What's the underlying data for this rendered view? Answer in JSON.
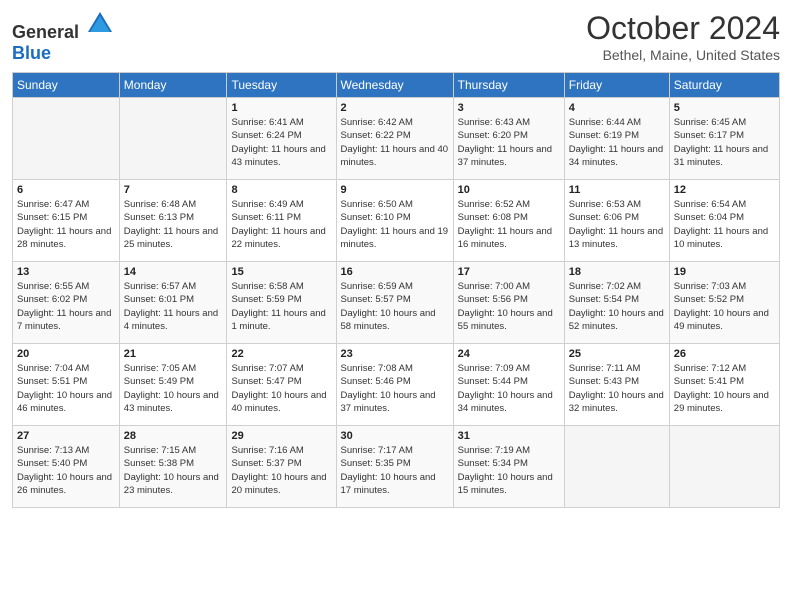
{
  "header": {
    "logo_general": "General",
    "logo_blue": "Blue",
    "title": "October 2024",
    "location": "Bethel, Maine, United States"
  },
  "weekdays": [
    "Sunday",
    "Monday",
    "Tuesday",
    "Wednesday",
    "Thursday",
    "Friday",
    "Saturday"
  ],
  "weeks": [
    [
      {
        "day": "",
        "sunrise": "",
        "sunset": "",
        "daylight": ""
      },
      {
        "day": "",
        "sunrise": "",
        "sunset": "",
        "daylight": ""
      },
      {
        "day": "1",
        "sunrise": "Sunrise: 6:41 AM",
        "sunset": "Sunset: 6:24 PM",
        "daylight": "Daylight: 11 hours and 43 minutes."
      },
      {
        "day": "2",
        "sunrise": "Sunrise: 6:42 AM",
        "sunset": "Sunset: 6:22 PM",
        "daylight": "Daylight: 11 hours and 40 minutes."
      },
      {
        "day": "3",
        "sunrise": "Sunrise: 6:43 AM",
        "sunset": "Sunset: 6:20 PM",
        "daylight": "Daylight: 11 hours and 37 minutes."
      },
      {
        "day": "4",
        "sunrise": "Sunrise: 6:44 AM",
        "sunset": "Sunset: 6:19 PM",
        "daylight": "Daylight: 11 hours and 34 minutes."
      },
      {
        "day": "5",
        "sunrise": "Sunrise: 6:45 AM",
        "sunset": "Sunset: 6:17 PM",
        "daylight": "Daylight: 11 hours and 31 minutes."
      }
    ],
    [
      {
        "day": "6",
        "sunrise": "Sunrise: 6:47 AM",
        "sunset": "Sunset: 6:15 PM",
        "daylight": "Daylight: 11 hours and 28 minutes."
      },
      {
        "day": "7",
        "sunrise": "Sunrise: 6:48 AM",
        "sunset": "Sunset: 6:13 PM",
        "daylight": "Daylight: 11 hours and 25 minutes."
      },
      {
        "day": "8",
        "sunrise": "Sunrise: 6:49 AM",
        "sunset": "Sunset: 6:11 PM",
        "daylight": "Daylight: 11 hours and 22 minutes."
      },
      {
        "day": "9",
        "sunrise": "Sunrise: 6:50 AM",
        "sunset": "Sunset: 6:10 PM",
        "daylight": "Daylight: 11 hours and 19 minutes."
      },
      {
        "day": "10",
        "sunrise": "Sunrise: 6:52 AM",
        "sunset": "Sunset: 6:08 PM",
        "daylight": "Daylight: 11 hours and 16 minutes."
      },
      {
        "day": "11",
        "sunrise": "Sunrise: 6:53 AM",
        "sunset": "Sunset: 6:06 PM",
        "daylight": "Daylight: 11 hours and 13 minutes."
      },
      {
        "day": "12",
        "sunrise": "Sunrise: 6:54 AM",
        "sunset": "Sunset: 6:04 PM",
        "daylight": "Daylight: 11 hours and 10 minutes."
      }
    ],
    [
      {
        "day": "13",
        "sunrise": "Sunrise: 6:55 AM",
        "sunset": "Sunset: 6:02 PM",
        "daylight": "Daylight: 11 hours and 7 minutes."
      },
      {
        "day": "14",
        "sunrise": "Sunrise: 6:57 AM",
        "sunset": "Sunset: 6:01 PM",
        "daylight": "Daylight: 11 hours and 4 minutes."
      },
      {
        "day": "15",
        "sunrise": "Sunrise: 6:58 AM",
        "sunset": "Sunset: 5:59 PM",
        "daylight": "Daylight: 11 hours and 1 minute."
      },
      {
        "day": "16",
        "sunrise": "Sunrise: 6:59 AM",
        "sunset": "Sunset: 5:57 PM",
        "daylight": "Daylight: 10 hours and 58 minutes."
      },
      {
        "day": "17",
        "sunrise": "Sunrise: 7:00 AM",
        "sunset": "Sunset: 5:56 PM",
        "daylight": "Daylight: 10 hours and 55 minutes."
      },
      {
        "day": "18",
        "sunrise": "Sunrise: 7:02 AM",
        "sunset": "Sunset: 5:54 PM",
        "daylight": "Daylight: 10 hours and 52 minutes."
      },
      {
        "day": "19",
        "sunrise": "Sunrise: 7:03 AM",
        "sunset": "Sunset: 5:52 PM",
        "daylight": "Daylight: 10 hours and 49 minutes."
      }
    ],
    [
      {
        "day": "20",
        "sunrise": "Sunrise: 7:04 AM",
        "sunset": "Sunset: 5:51 PM",
        "daylight": "Daylight: 10 hours and 46 minutes."
      },
      {
        "day": "21",
        "sunrise": "Sunrise: 7:05 AM",
        "sunset": "Sunset: 5:49 PM",
        "daylight": "Daylight: 10 hours and 43 minutes."
      },
      {
        "day": "22",
        "sunrise": "Sunrise: 7:07 AM",
        "sunset": "Sunset: 5:47 PM",
        "daylight": "Daylight: 10 hours and 40 minutes."
      },
      {
        "day": "23",
        "sunrise": "Sunrise: 7:08 AM",
        "sunset": "Sunset: 5:46 PM",
        "daylight": "Daylight: 10 hours and 37 minutes."
      },
      {
        "day": "24",
        "sunrise": "Sunrise: 7:09 AM",
        "sunset": "Sunset: 5:44 PM",
        "daylight": "Daylight: 10 hours and 34 minutes."
      },
      {
        "day": "25",
        "sunrise": "Sunrise: 7:11 AM",
        "sunset": "Sunset: 5:43 PM",
        "daylight": "Daylight: 10 hours and 32 minutes."
      },
      {
        "day": "26",
        "sunrise": "Sunrise: 7:12 AM",
        "sunset": "Sunset: 5:41 PM",
        "daylight": "Daylight: 10 hours and 29 minutes."
      }
    ],
    [
      {
        "day": "27",
        "sunrise": "Sunrise: 7:13 AM",
        "sunset": "Sunset: 5:40 PM",
        "daylight": "Daylight: 10 hours and 26 minutes."
      },
      {
        "day": "28",
        "sunrise": "Sunrise: 7:15 AM",
        "sunset": "Sunset: 5:38 PM",
        "daylight": "Daylight: 10 hours and 23 minutes."
      },
      {
        "day": "29",
        "sunrise": "Sunrise: 7:16 AM",
        "sunset": "Sunset: 5:37 PM",
        "daylight": "Daylight: 10 hours and 20 minutes."
      },
      {
        "day": "30",
        "sunrise": "Sunrise: 7:17 AM",
        "sunset": "Sunset: 5:35 PM",
        "daylight": "Daylight: 10 hours and 17 minutes."
      },
      {
        "day": "31",
        "sunrise": "Sunrise: 7:19 AM",
        "sunset": "Sunset: 5:34 PM",
        "daylight": "Daylight: 10 hours and 15 minutes."
      },
      {
        "day": "",
        "sunrise": "",
        "sunset": "",
        "daylight": ""
      },
      {
        "day": "",
        "sunrise": "",
        "sunset": "",
        "daylight": ""
      }
    ]
  ]
}
